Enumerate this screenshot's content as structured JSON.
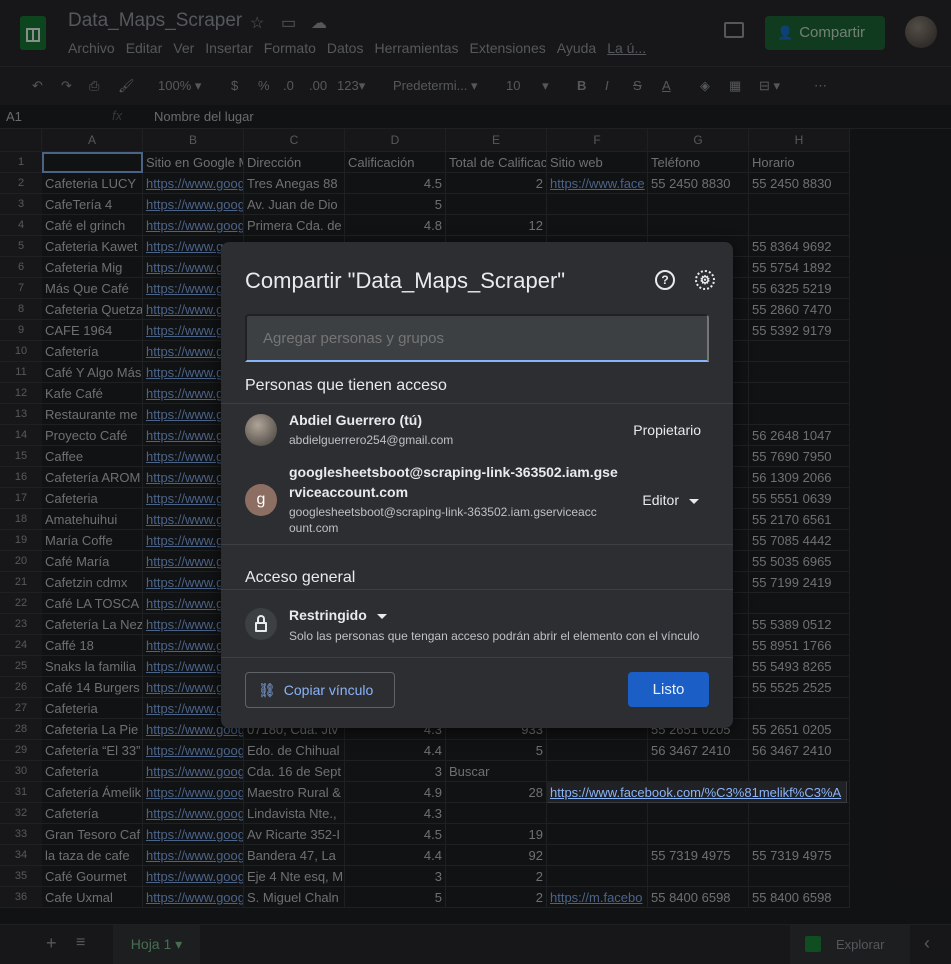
{
  "header": {
    "doc_title": "Data_Maps_Scraper",
    "menu": [
      "Archivo",
      "Editar",
      "Ver",
      "Insertar",
      "Formato",
      "Datos",
      "Herramientas",
      "Extensiones",
      "Ayuda",
      "La ú..."
    ],
    "share_label": "Compartir"
  },
  "toolbar": {
    "zoom": "100%",
    "currency": "$",
    "percent": "%",
    "dec_less": ".0",
    "dec_more": ".00",
    "format_more": "123",
    "font": "Predetermi...",
    "font_size": "10",
    "bold": "B",
    "italic": "I",
    "strike": "S",
    "text_color": "A"
  },
  "formula_bar": {
    "cell_ref": "A1",
    "fx": "fx",
    "content": "Nombre del lugar"
  },
  "columns": [
    "A",
    "B",
    "C",
    "D",
    "E",
    "F",
    "G",
    "H"
  ],
  "row_numbers": [
    "1",
    "2",
    "3",
    "4",
    "5",
    "6",
    "7",
    "8",
    "9",
    "10",
    "11",
    "12",
    "13",
    "14",
    "15",
    "16",
    "17",
    "18",
    "19",
    "20",
    "21",
    "22",
    "23",
    "24",
    "25",
    "26",
    "27",
    "28",
    "29",
    "30",
    "31",
    "32",
    "33",
    "34",
    "35",
    "36"
  ],
  "rows": [
    [
      "",
      "Sitio en Google M",
      "Dirección",
      "Calificación",
      "Total de Calificac",
      "Sitio web",
      "Teléfono",
      "Horario"
    ],
    [
      "Cafeteria LUCY",
      "https://www.goog",
      "Tres Anegas 88",
      "4.5",
      "2",
      "https://www.face",
      "55 2450 8830",
      "55 2450 8830"
    ],
    [
      "CafeTería 4",
      "https://www.goog",
      "Av. Juan de Dio",
      "5",
      "",
      "",
      "",
      ""
    ],
    [
      "Café el grinch",
      "https://www.goog",
      "Primera Cda. de",
      "4.8",
      "12",
      "",
      "",
      ""
    ],
    [
      "Cafeteria Kawet",
      "https://www.g",
      "",
      "",
      "",
      "",
      "",
      "55 8364 9692"
    ],
    [
      "Cafeteria Mig",
      "https://www.g",
      "",
      "",
      "",
      "",
      "",
      "55 5754 1892"
    ],
    [
      "Más Que Café",
      "https://www.g",
      "",
      "",
      "",
      "",
      "",
      "55 6325 5219"
    ],
    [
      "Cafeteria Quetza",
      "https://www.g",
      "",
      "",
      "",
      "",
      "",
      "55 2860 7470"
    ],
    [
      "CAFE 1964",
      "https://www.g",
      "",
      "",
      "",
      "",
      "",
      "55 5392 9179"
    ],
    [
      "Cafetería",
      "https://www.g",
      "",
      "",
      "",
      "",
      "",
      ""
    ],
    [
      "Café Y Algo Más",
      "https://www.g",
      "",
      "",
      "",
      "",
      "",
      ""
    ],
    [
      "Kafe Café",
      "https://www.g",
      "",
      "",
      "",
      "",
      "",
      ""
    ],
    [
      "Restaurante me",
      "https://www.g",
      "",
      "",
      "",
      "",
      "",
      ""
    ],
    [
      "Proyecto Café",
      "https://www.g",
      "",
      "",
      "",
      "",
      "",
      "56 2648 1047"
    ],
    [
      "Caffee",
      "https://www.g",
      "",
      "",
      "",
      "",
      "",
      "55 7690 7950"
    ],
    [
      "Cafetería AROM",
      "https://www.g",
      "",
      "",
      "",
      "",
      "",
      "56 1309 2066"
    ],
    [
      "Cafeteria",
      "https://www.g",
      "",
      "",
      "",
      "",
      "",
      "55 5551 0639"
    ],
    [
      "Amatehuihui",
      "https://www.g",
      "",
      "",
      "",
      "",
      "",
      "55 2170 6561"
    ],
    [
      "María Coffe",
      "https://www.g",
      "",
      "",
      "",
      "",
      "",
      "55 7085 4442"
    ],
    [
      "Café María",
      "https://www.g",
      "",
      "",
      "",
      "",
      "",
      "55 5035 6965"
    ],
    [
      "Cafetzin cdmx",
      "https://www.g",
      "",
      "",
      "",
      "",
      "",
      "55 7199 2419"
    ],
    [
      "Café LA TOSCA",
      "https://www.g",
      "",
      "",
      "",
      "",
      "",
      ""
    ],
    [
      "Cafetería La Nez",
      "https://www.g",
      "",
      "",
      "",
      "",
      "",
      "55 5389 0512"
    ],
    [
      "Caffé 18",
      "https://www.g",
      "",
      "",
      "",
      "",
      "",
      "55 8951 1766"
    ],
    [
      "Snaks la familia",
      "https://www.g",
      "",
      "",
      "",
      "",
      "",
      "55 5493 8265"
    ],
    [
      "Café 14 Burgers",
      "https://www.g",
      "",
      "",
      "",
      "",
      "",
      "55 5525 2525"
    ],
    [
      "Cafeteria",
      "https://www.g",
      "",
      "",
      "",
      "",
      "",
      ""
    ],
    [
      "Cafeteria La Pie",
      "https://www.goog",
      "07180, Cda. Jtv",
      "4.3",
      "933",
      "",
      "55 2651 0205",
      "55 2651 0205"
    ],
    [
      "Cafetería “El 33”",
      "https://www.goog",
      "Edo. de Chihual",
      "4.4",
      "5",
      "",
      "56 3467 2410",
      "56 3467 2410"
    ],
    [
      "Cafetería",
      "https://www.goog",
      "Cda. 16 de Sept",
      "3",
      "Buscar",
      "",
      "",
      ""
    ],
    [
      "Cafetería Ámelik",
      "https://www.goog",
      "Maestro Rural &",
      "4.9",
      "28",
      "https://www.facebook.com/%C3%81melikf%C3%A",
      "",
      ""
    ],
    [
      "Cafetería",
      "https://www.goog",
      "Lindavista Nte.,",
      "4.3",
      "",
      "",
      "",
      ""
    ],
    [
      "Gran Tesoro Caf",
      "https://www.goog",
      "Av Ricarte 352-I",
      "4.5",
      "19",
      "",
      "",
      ""
    ],
    [
      "la taza de cafe",
      "https://www.goog",
      "Bandera 47, La",
      "4.4",
      "92",
      "",
      "55 7319 4975",
      "55 7319 4975"
    ],
    [
      "Café Gourmet",
      "https://www.goog",
      "Eje 4 Nte esq, M",
      "3",
      "2",
      "",
      "",
      ""
    ],
    [
      "Cafe Uxmal",
      "https://www.goog",
      "S. Miguel Chaln",
      "5",
      "2",
      "https://m.facebo",
      "55 8400 6598",
      "55 8400 6598"
    ]
  ],
  "bottom": {
    "add": "+",
    "sheet_tab": "Hoja 1",
    "explore": "Explorar"
  },
  "dialog": {
    "title": "Compartir \"Data_Maps_Scraper\"",
    "add_placeholder": "Agregar personas y grupos",
    "people_title": "Personas que tienen acceso",
    "owner": {
      "name": "Abdiel Guerrero (tú)",
      "email": "abdielguerrero254@gmail.com",
      "role": "Propietario"
    },
    "editor": {
      "avatar_letter": "g",
      "name_line1": "googlesheetsboot@scraping-link-363502.iam.gse",
      "name_line2": "rviceaccount.com",
      "email_line1": "googlesheetsboot@scraping-link-363502.iam.gserviceacc",
      "email_line2": "ount.com",
      "role": "Editor"
    },
    "general_title": "Acceso general",
    "restriction": "Restringido",
    "restriction_desc": "Solo las personas que tengan acceso podrán abrir el elemento con el vínculo",
    "copy_link": "Copiar vínculo",
    "done": "Listo"
  }
}
